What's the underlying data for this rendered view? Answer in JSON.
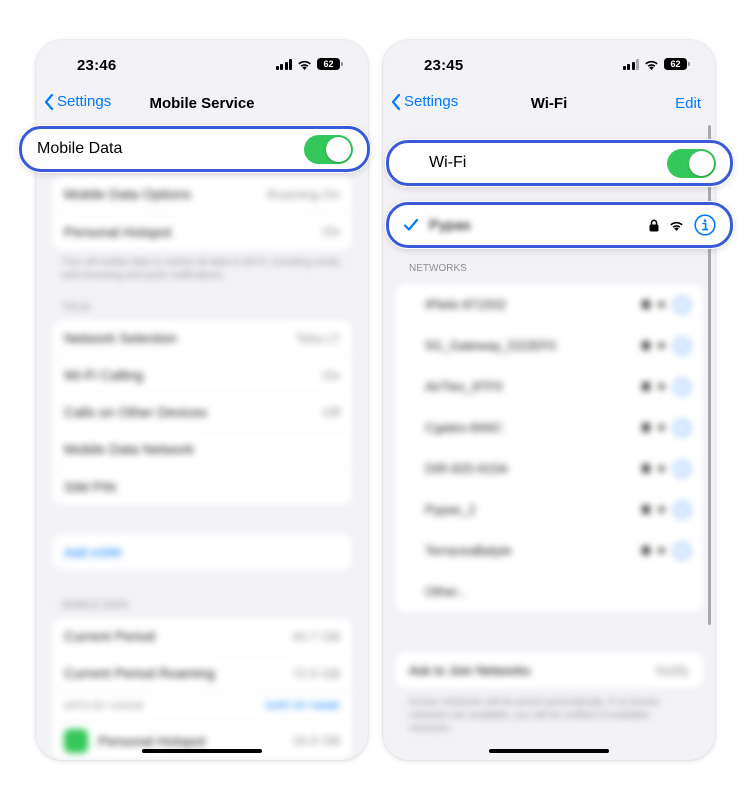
{
  "left": {
    "time": "23:46",
    "battery": "62",
    "back_label": "Settings",
    "title": "Mobile Service",
    "mobile_data_label": "Mobile Data",
    "blurred_rows_1": [
      {
        "label": "Mobile Data Options",
        "value": "Roaming On"
      },
      {
        "label": "Personal Hotspot",
        "value": "On"
      }
    ],
    "footer_1": "Turn off mobile data to restrict all data to Wi-Fi, including email, web browsing and push notifications.",
    "section_1": "Telia",
    "blurred_rows_2": [
      {
        "label": "Network Selection",
        "value": "Telia LT"
      },
      {
        "label": "Wi-Fi Calling",
        "value": "On"
      },
      {
        "label": "Calls on Other Devices",
        "value": "Off"
      },
      {
        "label": "Mobile Data Network",
        "value": ""
      },
      {
        "label": "SIM PIN",
        "value": ""
      }
    ],
    "add_esim": "Add eSIM",
    "section_2": "Mobile Data",
    "blurred_rows_3": [
      {
        "label": "Current Period",
        "value": "40.7 GB"
      },
      {
        "label": "Current Period Roaming",
        "value": "72.5 GB"
      }
    ],
    "apps_header": "APPS BY USAGE",
    "apps_sort": "SORT BY NAME",
    "app_row": {
      "label": "Personal Hotspot",
      "value": "16.9 GB"
    }
  },
  "right": {
    "time": "23:45",
    "battery": "62",
    "back_label": "Settings",
    "title": "Wi-Fi",
    "edit_label": "Edit",
    "wifi_label": "Wi-Fi",
    "connected_network": "Pypas",
    "networks_header": "NETWORKS",
    "networks": [
      "IPtele-971502",
      "5G_Gateway_D22EF0",
      "AirTies_8TF0",
      "Cgates-8A6C",
      "DIR-825-915A",
      "Pypas_2",
      "TerraceaBalyte",
      "Other..."
    ],
    "ask_join_label": "Ask to Join Networks",
    "ask_join_value": "Notify",
    "ask_join_footer": "Known networks will be joined automatically. If no known networks are available, you will be notified of available networks."
  },
  "colors": {
    "accent": "#007aff",
    "toggle_on": "#34c759",
    "highlight_border": "#3a5bd9"
  }
}
